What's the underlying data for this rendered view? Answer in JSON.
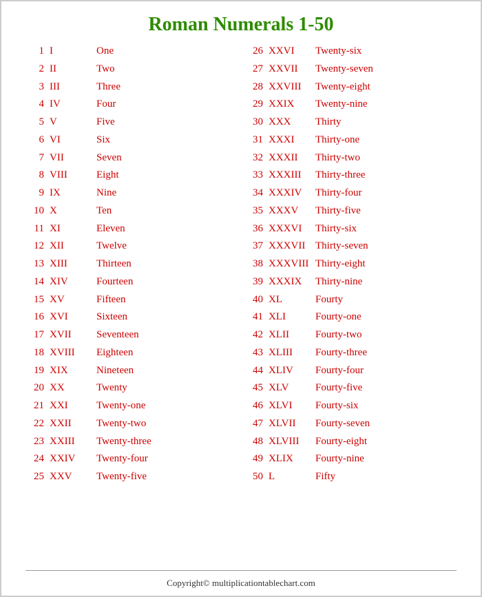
{
  "title": "Roman Numerals 1-50",
  "footer": "Copyright© multiplicationtablechart.com",
  "left": [
    {
      "num": "1",
      "roman": "I",
      "word": "One"
    },
    {
      "num": "2",
      "roman": "II",
      "word": "Two"
    },
    {
      "num": "3",
      "roman": "III",
      "word": "Three"
    },
    {
      "num": "4",
      "roman": "IV",
      "word": "Four"
    },
    {
      "num": "5",
      "roman": "V",
      "word": "Five"
    },
    {
      "num": "6",
      "roman": "VI",
      "word": "Six"
    },
    {
      "num": "7",
      "roman": "VII",
      "word": "Seven"
    },
    {
      "num": "8",
      "roman": "VIII",
      "word": "Eight"
    },
    {
      "num": "9",
      "roman": "IX",
      "word": "Nine"
    },
    {
      "num": "10",
      "roman": "X",
      "word": "Ten"
    },
    {
      "num": "11",
      "roman": "XI",
      "word": "Eleven"
    },
    {
      "num": "12",
      "roman": "XII",
      "word": "Twelve"
    },
    {
      "num": "13",
      "roman": "XIII",
      "word": "Thirteen"
    },
    {
      "num": "14",
      "roman": "XIV",
      "word": "Fourteen"
    },
    {
      "num": "15",
      "roman": "XV",
      "word": "Fifteen"
    },
    {
      "num": "16",
      "roman": "XVI",
      "word": "Sixteen"
    },
    {
      "num": "17",
      "roman": "XVII",
      "word": "Seventeen"
    },
    {
      "num": "18",
      "roman": "XVIII",
      "word": "Eighteen"
    },
    {
      "num": "19",
      "roman": "XIX",
      "word": "Nineteen"
    },
    {
      "num": "20",
      "roman": "XX",
      "word": "Twenty"
    },
    {
      "num": "21",
      "roman": "XXI",
      "word": "Twenty-one"
    },
    {
      "num": "22",
      "roman": "XXII",
      "word": "Twenty-two"
    },
    {
      "num": "23",
      "roman": "XXIII",
      "word": "Twenty-three"
    },
    {
      "num": "24",
      "roman": "XXIV",
      "word": "Twenty-four"
    },
    {
      "num": "25",
      "roman": "XXV",
      "word": "Twenty-five"
    }
  ],
  "right": [
    {
      "num": "26",
      "roman": "XXVI",
      "word": "Twenty-six"
    },
    {
      "num": "27",
      "roman": "XXVII",
      "word": "Twenty-seven"
    },
    {
      "num": "28",
      "roman": "XXVIII",
      "word": "Twenty-eight"
    },
    {
      "num": "29",
      "roman": "XXIX",
      "word": "Twenty-nine"
    },
    {
      "num": "30",
      "roman": "XXX",
      "word": "Thirty"
    },
    {
      "num": "31",
      "roman": "XXXI",
      "word": "Thirty-one"
    },
    {
      "num": "32",
      "roman": "XXXII",
      "word": "Thirty-two"
    },
    {
      "num": "33",
      "roman": "XXXIII",
      "word": "Thirty-three"
    },
    {
      "num": "34",
      "roman": "XXXIV",
      "word": "Thirty-four"
    },
    {
      "num": "35",
      "roman": "XXXV",
      "word": "Thirty-five"
    },
    {
      "num": "36",
      "roman": "XXXVI",
      "word": "Thirty-six"
    },
    {
      "num": "37",
      "roman": "XXXVII",
      "word": "Thirty-seven"
    },
    {
      "num": "38",
      "roman": "XXXVIII",
      "word": "Thirty-eight"
    },
    {
      "num": "39",
      "roman": "XXXIX",
      "word": "Thirty-nine"
    },
    {
      "num": "40",
      "roman": "XL",
      "word": "Fourty"
    },
    {
      "num": "41",
      "roman": "XLI",
      "word": "Fourty-one"
    },
    {
      "num": "42",
      "roman": "XLII",
      "word": "Fourty-two"
    },
    {
      "num": "43",
      "roman": "XLIII",
      "word": "Fourty-three"
    },
    {
      "num": "44",
      "roman": "XLIV",
      "word": "Fourty-four"
    },
    {
      "num": "45",
      "roman": "XLV",
      "word": "Fourty-five"
    },
    {
      "num": "46",
      "roman": "XLVI",
      "word": "Fourty-six"
    },
    {
      "num": "47",
      "roman": "XLVII",
      "word": "Fourty-seven"
    },
    {
      "num": "48",
      "roman": "XLVIII",
      "word": "Fourty-eight"
    },
    {
      "num": "49",
      "roman": "XLIX",
      "word": "Fourty-nine"
    },
    {
      "num": "50",
      "roman": "L",
      "word": "Fifty"
    }
  ]
}
